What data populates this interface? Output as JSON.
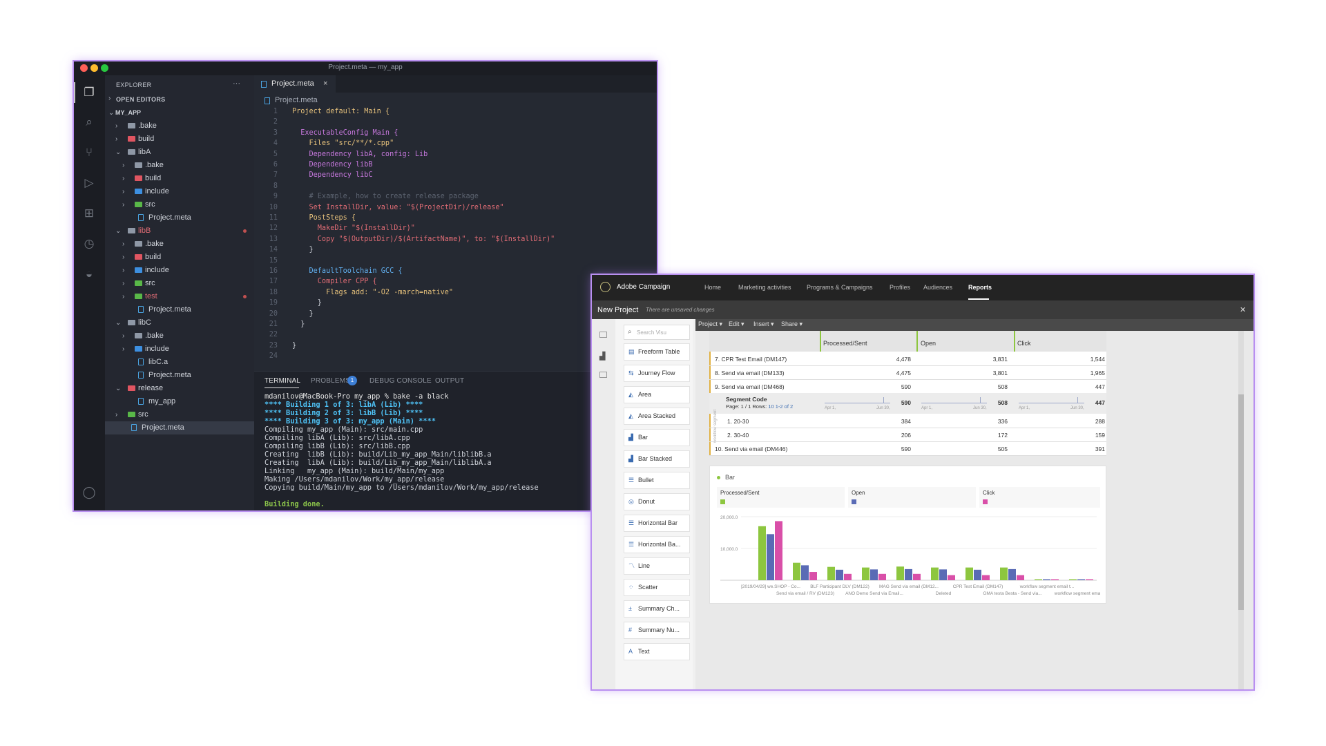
{
  "vscode": {
    "window_title": "Project.meta — my_app",
    "explorer_label": "EXPLORER",
    "explorer_more": "···",
    "open_editors_label": "OPEN EDITORS",
    "tree": [
      {
        "label": "MY_APP",
        "depth": 0,
        "type": "root",
        "open": true
      },
      {
        "label": ".bake",
        "depth": 1,
        "type": "folder-grey",
        "open": false
      },
      {
        "label": "build",
        "depth": 1,
        "type": "folder-red",
        "open": false
      },
      {
        "label": "libA",
        "depth": 1,
        "type": "folder-grey",
        "open": true
      },
      {
        "label": ".bake",
        "depth": 2,
        "type": "folder-grey",
        "open": false
      },
      {
        "label": "build",
        "depth": 2,
        "type": "folder-red",
        "open": false
      },
      {
        "label": "include",
        "depth": 2,
        "type": "folder-blue",
        "open": false
      },
      {
        "label": "src",
        "depth": 2,
        "type": "folder-green",
        "open": false
      },
      {
        "label": "Project.meta",
        "depth": 2,
        "type": "file"
      },
      {
        "label": "libB",
        "depth": 1,
        "type": "folder-grey",
        "open": true,
        "modified": true
      },
      {
        "label": ".bake",
        "depth": 2,
        "type": "folder-grey",
        "open": false
      },
      {
        "label": "build",
        "depth": 2,
        "type": "folder-red",
        "open": false
      },
      {
        "label": "include",
        "depth": 2,
        "type": "folder-blue",
        "open": false
      },
      {
        "label": "src",
        "depth": 2,
        "type": "folder-green",
        "open": false
      },
      {
        "label": "test",
        "depth": 2,
        "type": "folder-green",
        "open": false,
        "modified": true
      },
      {
        "label": "Project.meta",
        "depth": 2,
        "type": "file"
      },
      {
        "label": "libC",
        "depth": 1,
        "type": "folder-grey",
        "open": true
      },
      {
        "label": ".bake",
        "depth": 2,
        "type": "folder-grey",
        "open": false
      },
      {
        "label": "include",
        "depth": 2,
        "type": "folder-blue",
        "open": false
      },
      {
        "label": "libC.a",
        "depth": 2,
        "type": "file"
      },
      {
        "label": "Project.meta",
        "depth": 2,
        "type": "file"
      },
      {
        "label": "release",
        "depth": 1,
        "type": "folder-red",
        "open": true
      },
      {
        "label": "my_app",
        "depth": 2,
        "type": "file"
      },
      {
        "label": "src",
        "depth": 1,
        "type": "folder-green",
        "open": false
      },
      {
        "label": "Project.meta",
        "depth": 1,
        "type": "file",
        "selected": true
      }
    ],
    "tab_label": "Project.meta",
    "breadcrumb": "Project.meta",
    "code": [
      {
        "n": "1",
        "t": "Project default: Main {",
        "c": "#e5c07b"
      },
      {
        "n": "2",
        "t": "",
        "c": "#cfd3da"
      },
      {
        "n": "3",
        "t": "  ExecutableConfig Main {",
        "c": "#c678dd"
      },
      {
        "n": "4",
        "t": "    Files \"src/**/*.cpp\"",
        "c": "#e5c07b"
      },
      {
        "n": "5",
        "t": "    Dependency libA, config: Lib",
        "c": "#c678dd"
      },
      {
        "n": "6",
        "t": "    Dependency libB",
        "c": "#c678dd"
      },
      {
        "n": "7",
        "t": "    Dependency libC",
        "c": "#c678dd"
      },
      {
        "n": "8",
        "t": "",
        "c": "#cfd3da"
      },
      {
        "n": "9",
        "t": "    # Example, how to create release package",
        "c": "#5c6370"
      },
      {
        "n": "10",
        "t": "    Set InstallDir, value: \"$(ProjectDir)/release\"",
        "c": "#e06c75"
      },
      {
        "n": "11",
        "t": "    PostSteps {",
        "c": "#e5c07b"
      },
      {
        "n": "12",
        "t": "      MakeDir \"$(InstallDir)\"",
        "c": "#e06c75"
      },
      {
        "n": "13",
        "t": "      Copy \"$(OutputDir)/$(ArtifactName)\", to: \"$(InstallDir)\"",
        "c": "#e06c75"
      },
      {
        "n": "14",
        "t": "    }",
        "c": "#cfd3da"
      },
      {
        "n": "15",
        "t": "",
        "c": "#cfd3da"
      },
      {
        "n": "16",
        "t": "    DefaultToolchain GCC {",
        "c": "#61afef"
      },
      {
        "n": "17",
        "t": "      Compiler CPP {",
        "c": "#e06c75"
      },
      {
        "n": "18",
        "t": "        Flags add: \"-O2 -march=native\"",
        "c": "#e5c07b"
      },
      {
        "n": "19",
        "t": "      }",
        "c": "#cfd3da"
      },
      {
        "n": "20",
        "t": "    }",
        "c": "#cfd3da"
      },
      {
        "n": "21",
        "t": "  }",
        "c": "#cfd3da"
      },
      {
        "n": "22",
        "t": "",
        "c": "#cfd3da"
      },
      {
        "n": "23",
        "t": "}",
        "c": "#cfd3da"
      },
      {
        "n": "24",
        "t": "",
        "c": "#cfd3da"
      }
    ],
    "panel_tabs": [
      "TERMINAL",
      "PROBLEMS",
      "DEBUG CONSOLE",
      "OUTPUT"
    ],
    "problems_count": "1",
    "terminal": [
      {
        "t": "mdanilov@MacBook-Pro my_app % bake -a black",
        "c": "#e6e6e6",
        "b": false
      },
      {
        "t": "**** Building 1 of 3: libA (Lib) ****",
        "c": "#4fc3f7",
        "b": true
      },
      {
        "t": "**** Building 2 of 3: libB (Lib) ****",
        "c": "#4fc3f7",
        "b": true
      },
      {
        "t": "**** Building 3 of 3: my_app (Main) ****",
        "c": "#4fc3f7",
        "b": true
      },
      {
        "t": "Compiling my_app (Main): src/main.cpp",
        "c": "#cfd3da",
        "b": false
      },
      {
        "t": "Compiling libA (Lib): src/libA.cpp",
        "c": "#cfd3da",
        "b": false
      },
      {
        "t": "Compiling libB (Lib): src/libB.cpp",
        "c": "#cfd3da",
        "b": false
      },
      {
        "t": "Creating  libB (Lib): build/Lib_my_app_Main/liblibB.a",
        "c": "#cfd3da",
        "b": false
      },
      {
        "t": "Creating  libA (Lib): build/Lib_my_app_Main/liblibA.a",
        "c": "#cfd3da",
        "b": false
      },
      {
        "t": "Linking   my_app (Main): build/Main/my_app",
        "c": "#cfd3da",
        "b": false
      },
      {
        "t": "Making /Users/mdanilov/Work/my_app/release",
        "c": "#cfd3da",
        "b": false
      },
      {
        "t": "Copying build/Main/my_app to /Users/mdanilov/Work/my_app/release",
        "c": "#cfd3da",
        "b": false
      },
      {
        "t": "",
        "c": "#cfd3da",
        "b": false
      },
      {
        "t": "Building done.",
        "c": "#8bc34a",
        "b": true
      }
    ]
  },
  "adobe": {
    "brand": "Adobe Campaign",
    "nav": [
      "Home",
      "Marketing activities",
      "Programs & Campaigns",
      "Profiles",
      "Audiences",
      "Reports"
    ],
    "project_title": "New Project",
    "unsaved": "There are unsaved changes",
    "close": "✕",
    "search_placeholder": "Search Visu",
    "toolbar": [
      "Project",
      "Edit",
      "Insert",
      "Share"
    ],
    "viz_items": [
      {
        "label": "Freeform Table",
        "icon": "table-icon"
      },
      {
        "label": "Journey Flow",
        "icon": "flow-icon"
      },
      {
        "label": "Area",
        "icon": "area-icon"
      },
      {
        "label": "Area Stacked",
        "icon": "area-stacked-icon"
      },
      {
        "label": "Bar",
        "icon": "bar-icon"
      },
      {
        "label": "Bar Stacked",
        "icon": "bar-stacked-icon"
      },
      {
        "label": "Bullet",
        "icon": "bullet-icon"
      },
      {
        "label": "Donut",
        "icon": "donut-icon"
      },
      {
        "label": "Horizontal Bar",
        "icon": "hbar-icon"
      },
      {
        "label": "Horizontal Ba...",
        "icon": "hbar-stacked-icon"
      },
      {
        "label": "Line",
        "icon": "line-icon"
      },
      {
        "label": "Scatter",
        "icon": "scatter-icon"
      },
      {
        "label": "Summary Ch...",
        "icon": "summary-change-icon"
      },
      {
        "label": "Summary Nu...",
        "icon": "summary-number-icon"
      },
      {
        "label": "Text",
        "icon": "text-icon"
      }
    ],
    "table": {
      "headers": [
        "Processed/Sent",
        "Open",
        "Click"
      ],
      "rows": [
        {
          "label": "7.  CPR Test Email (DM147)",
          "v": [
            "4,478",
            "3,831",
            "1,544"
          ]
        },
        {
          "label": "8.  Send via email (DM133)",
          "v": [
            "4,475",
            "3,801",
            "1,965"
          ]
        },
        {
          "label": "9.  Send via email (DM468)",
          "v": [
            "590",
            "508",
            "447"
          ]
        }
      ],
      "segment": {
        "title": "Segment Code",
        "sub": "Page: 1 / 1 Rows:",
        "rows_n": "10",
        "range": "1-2 of 2",
        "v": [
          "590",
          "508",
          "447"
        ],
        "spark_left": "Apr 1,",
        "spark_right": "Jun 30,"
      },
      "sub_rows": [
        {
          "label": "1.  20-30",
          "v": [
            "384",
            "336",
            "288"
          ]
        },
        {
          "label": "2.  30-40",
          "v": [
            "206",
            "172",
            "159"
          ]
        }
      ],
      "last_row": {
        "label": "10.  Send via email (DM446)",
        "v": [
          "590",
          "505",
          "391"
        ]
      },
      "side_label": "workflow segment"
    },
    "bar_panel_title": "Bar"
  },
  "chart_data": {
    "type": "bar",
    "series": [
      {
        "name": "Processed/Sent",
        "color": "#8dc63f",
        "values": [
          17000,
          5500,
          4200,
          4000,
          4300,
          4000,
          4000,
          4000,
          300,
          300
        ]
      },
      {
        "name": "Open",
        "color": "#5a6bb5",
        "values": [
          14500,
          4700,
          3300,
          3400,
          3500,
          3400,
          3300,
          3500,
          300,
          300
        ]
      },
      {
        "name": "Click",
        "color": "#d94fa8",
        "values": [
          18600,
          2600,
          2000,
          2000,
          2000,
          1600,
          1600,
          1600,
          300,
          300
        ]
      }
    ],
    "categories": [
      "[2019/04/29] we.SHOP - Co...",
      "Send via email / RV (DM123)",
      "BLF Participant DLV (DM122)",
      "ANO Demo Send via Email...",
      "MAG Send via email (DM12...",
      "Deleted",
      "CPR Test Email (DM147)",
      "GMA testa Besta - Send via...",
      "workflow segment email t...",
      "workflow segment email t..."
    ],
    "yticks": [
      "20,000.0",
      "10,000.0"
    ],
    "ylim": [
      0,
      20000
    ]
  }
}
